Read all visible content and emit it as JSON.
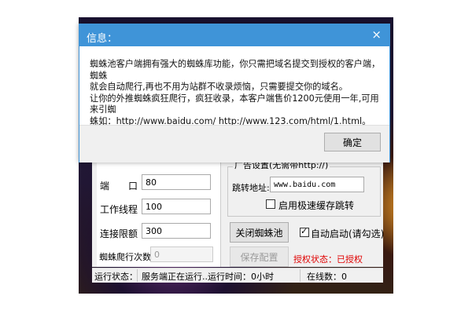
{
  "dialog": {
    "title": "信息：",
    "close_glyph": "×",
    "line1": "蜘蛛池客户端拥有强大的蜘蛛库功能，你只需把域名提交到授权的客户端，蜘蛛",
    "line2": "就会自动爬行,再也不用为站群不收录烦恼，只需要提交你的域名。",
    "line3": "让你的外推蜘蛛疯狂爬行，疯狂收录，本客户端售价1200元使用一年,可用来引蜘",
    "line4": "蛛如：http://www.baidu.com/   http://www.123.com/html/1.html。",
    "ok_label": "确定"
  },
  "settings": {
    "port_label": "端　　口",
    "port_value": "80",
    "threads_label": "工作线程",
    "threads_value": "100",
    "quota_label": "连接限额",
    "quota_value": "300",
    "crawl_label": "蜘蛛爬行次数",
    "crawl_value": "0"
  },
  "ad": {
    "group_title": "广告设置(无需带http://)",
    "redirect_label": "跳转地址:",
    "redirect_value": "www.baidu.com",
    "fast_cache_label": "启用极速缓存跳转",
    "fast_cache_checked": false
  },
  "controls": {
    "close_pool_label": "关闭蜘蛛池",
    "auto_start_label": "自动启动(请勾选)",
    "auto_start_checked": true,
    "save_label": "保存配置",
    "auth_status": "授权状态：已授权",
    "auth_color": "#e00000"
  },
  "status": {
    "run_label": "运行状态：",
    "run_text": "服务端正在运行..运行时间：0小时",
    "online_text": "在线数：0"
  },
  "colors": {
    "dialog_title_bg": "#3f94d8"
  }
}
